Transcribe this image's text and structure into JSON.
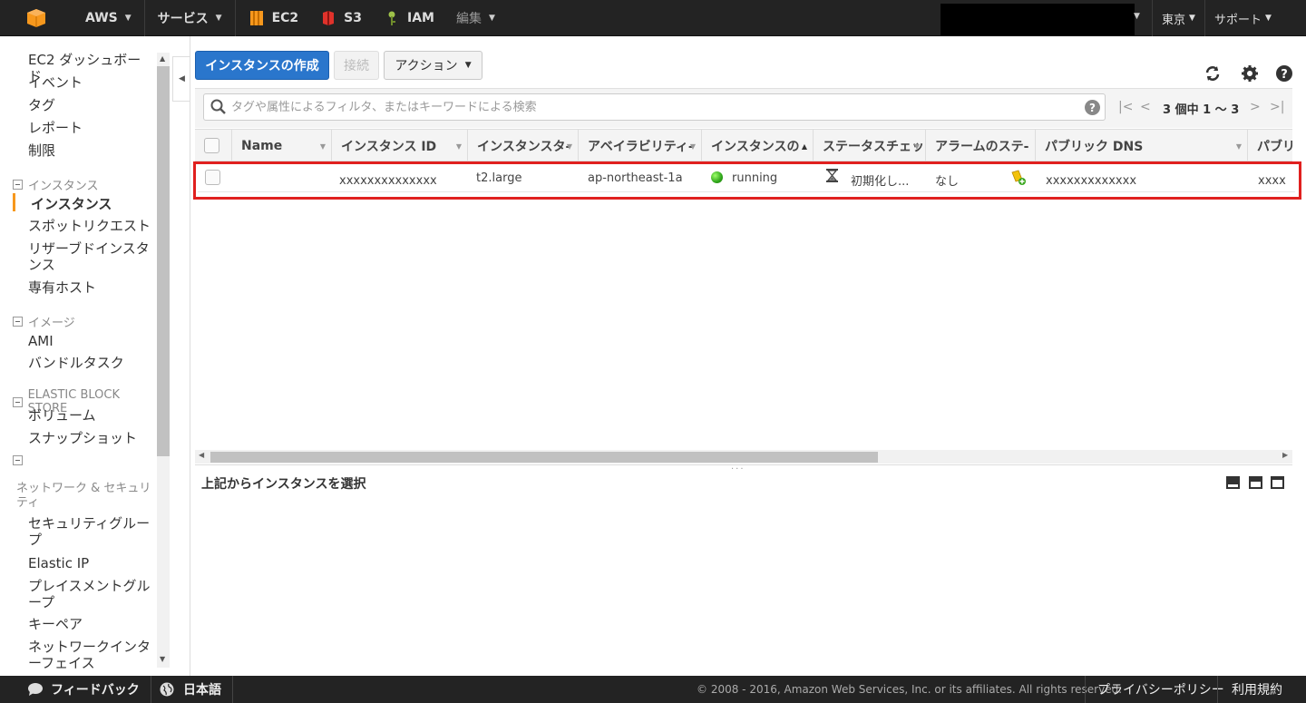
{
  "topbar": {
    "brand": "AWS",
    "services": "サービス",
    "ec2": "EC2",
    "s3": "S3",
    "iam": "IAM",
    "edit": "編集",
    "region": "東京",
    "support": "サポート"
  },
  "sidebar": {
    "top_links": [
      "EC2 ダッシュボード",
      "イベント",
      "タグ",
      "レポート",
      "制限"
    ],
    "section_instances": "インスタンス",
    "instances_links": [
      "インスタンス",
      "スポットリクエスト",
      "リザーブドインスタンス",
      "専有ホスト"
    ],
    "section_images": "イメージ",
    "images_links": [
      "AMI",
      "バンドルタスク"
    ],
    "section_ebs": "ELASTIC BLOCK STORE",
    "ebs_links": [
      "ボリューム",
      "スナップショット"
    ],
    "section_network": "ネットワーク & セキュリティ",
    "network_links": [
      "セキュリティグループ",
      "Elastic IP",
      "プレイスメントグループ",
      "キーペア",
      "ネットワークインターフェイス"
    ]
  },
  "toolbar": {
    "create_label": "インスタンスの作成",
    "connect_label": "接続",
    "action_label": "アクション"
  },
  "filter": {
    "placeholder": "タグや属性によるフィルタ、またはキーワードによる検索",
    "pager": "3 個中 1 〜 3"
  },
  "table": {
    "columns": [
      "Name",
      "インスタンス ID",
      "インスタンスタ-",
      "アベイラビリティ-",
      "インスタンスの",
      "ステータスチェッ",
      "アラームのステ-",
      "パブリック DNS",
      "パブリ"
    ],
    "row": {
      "name": "",
      "instance_id": "xxxxxxxxxxxxxx",
      "type": "t2.large",
      "az": "ap-northeast-1a",
      "state": "running",
      "status_check": "初期化し...",
      "alarm": "なし",
      "public_dns": "xxxxxxxxxxxxx",
      "public_ip": "xxxx"
    }
  },
  "detail": {
    "title": "上記からインスタンスを選択"
  },
  "footer": {
    "feedback": "フィードバック",
    "language": "日本語",
    "copyright": "© 2008 - 2016, Amazon Web Services, Inc. or its affiliates. All rights reserved.",
    "privacy": "プライバシーポリシー",
    "terms": "利用規約"
  },
  "colors": {
    "primary": "#2a76cc",
    "highlight": "#e0201f",
    "topbar": "#232323",
    "active_marker": "#f7981d"
  }
}
